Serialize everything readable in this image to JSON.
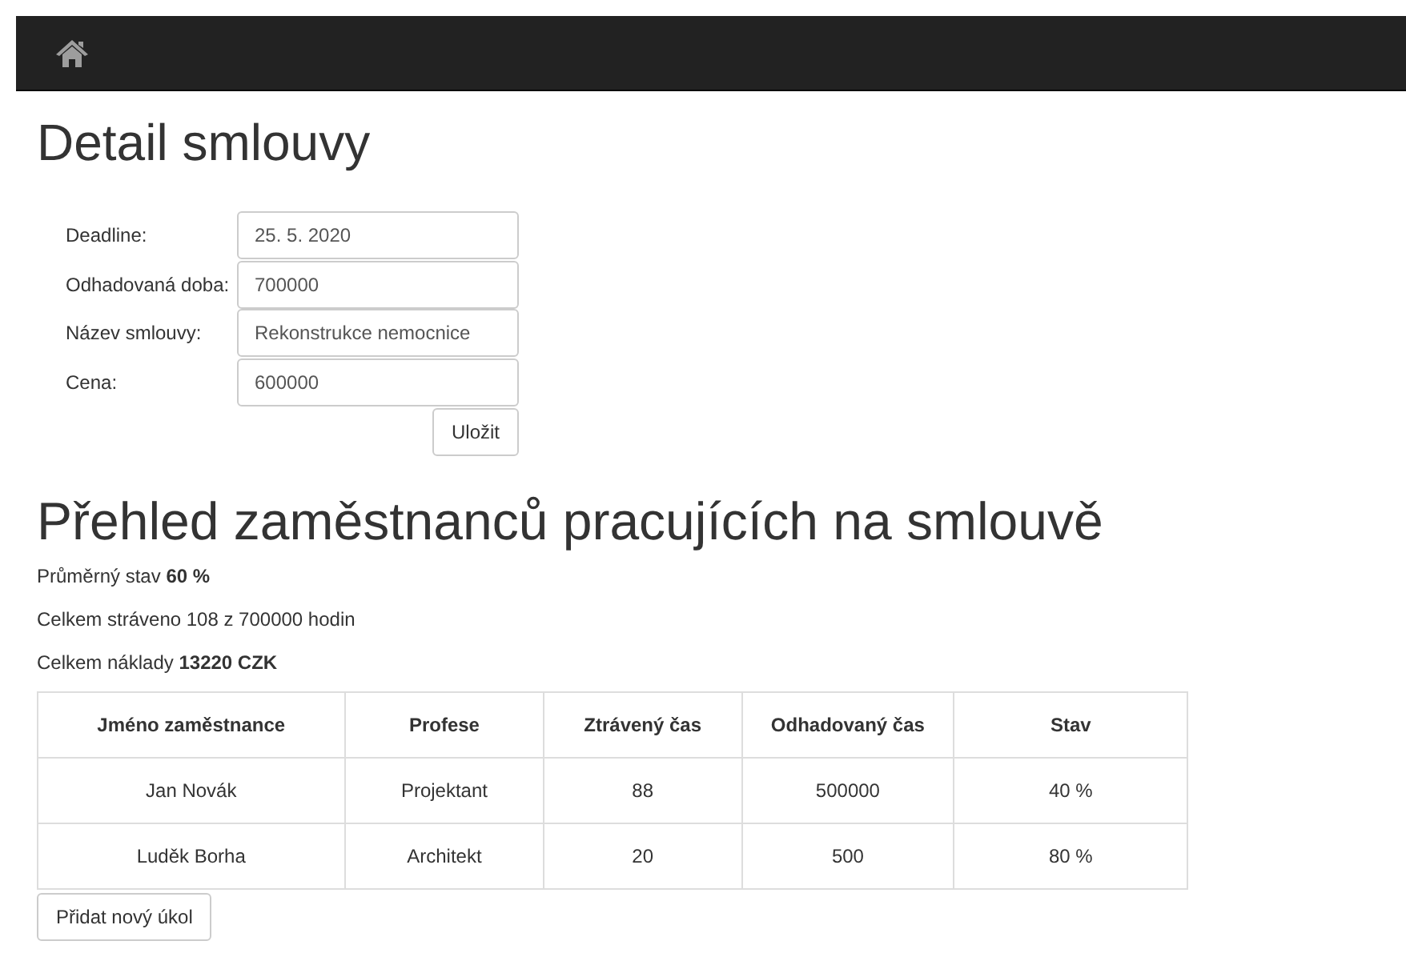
{
  "title": "Detail smlouvy",
  "form": {
    "fields": [
      {
        "label": "Deadline:",
        "value": "25. 5. 2020"
      },
      {
        "label": "Odhadovaná doba:",
        "value": "700000"
      },
      {
        "label": "Název smlouvy:",
        "value": "Rekonstrukce nemocnice"
      },
      {
        "label": "Cena:",
        "value": "600000"
      }
    ],
    "submit": "Uložit"
  },
  "overview": {
    "title": "Přehled zaměstnanců pracujících na smlouvě",
    "stats": [
      "Průměrný stav **60 %**",
      "Celkem stráveno 108 z 700000 hodin",
      "Celkem náklady **13220 CZK**"
    ],
    "table": {
      "columns": [
        "Jméno zaměstnance",
        "Profese",
        "Ztrávený čas",
        "Odhadovaný čas",
        "Stav"
      ],
      "rows": [
        [
          "Jan Novák",
          "Projektant",
          "88",
          "500000",
          "40 %"
        ],
        [
          "Luděk Borha",
          "Architekt",
          "20",
          "500",
          "80 %"
        ]
      ]
    },
    "add_button": "Přidat nový úkol"
  }
}
